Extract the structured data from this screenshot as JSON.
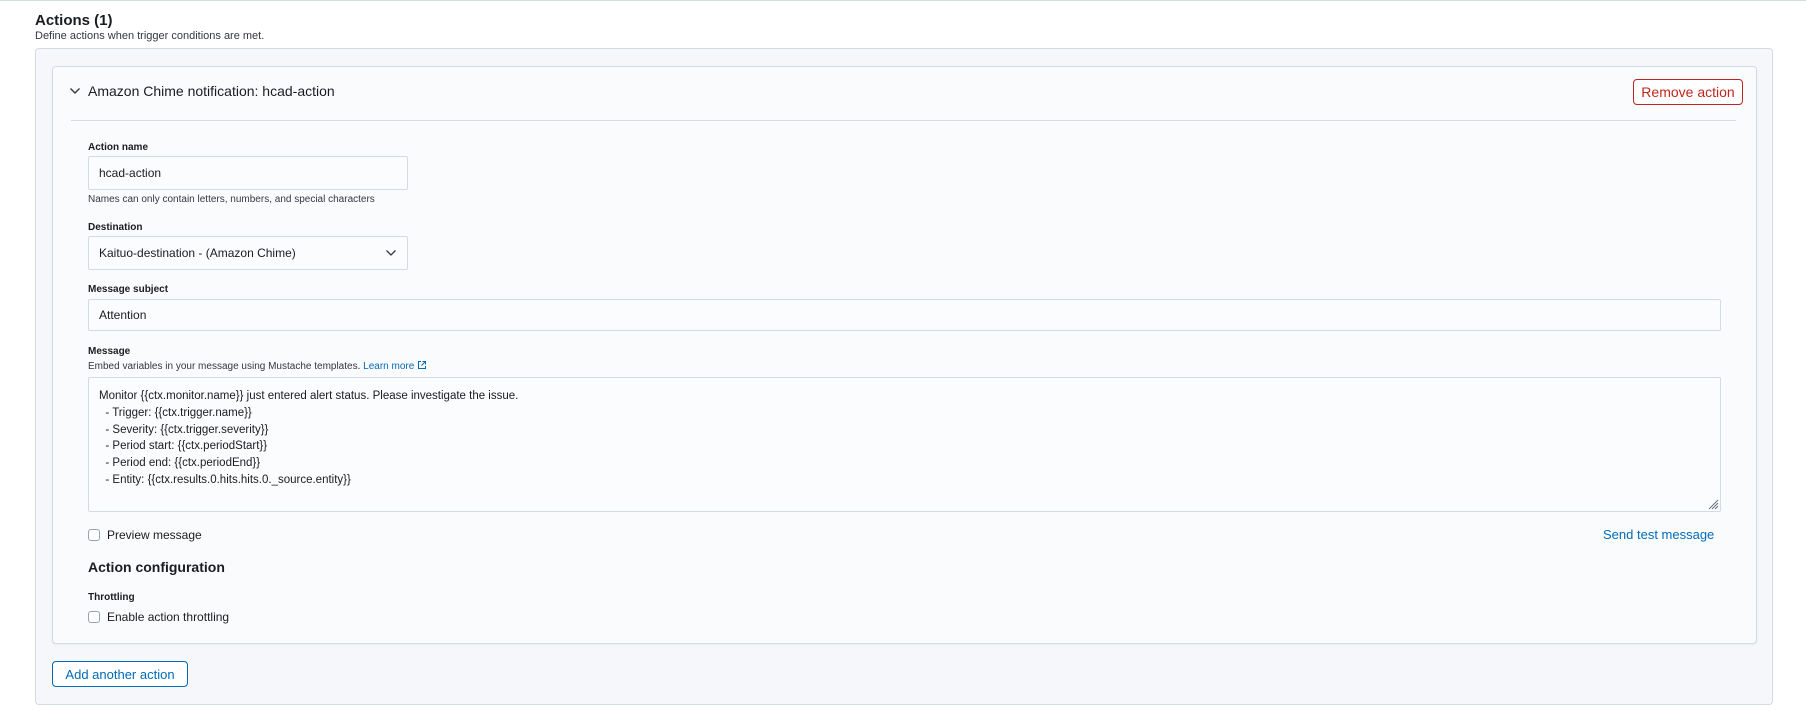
{
  "header": {
    "title": "Actions (1)",
    "description": "Define actions when trigger conditions are met."
  },
  "action": {
    "accordion_title": "Amazon Chime notification: hcad-action",
    "remove_label": "Remove action",
    "action_name": {
      "label": "Action name",
      "value": "hcad-action",
      "help": "Names can only contain letters, numbers, and special characters"
    },
    "destination": {
      "label": "Destination",
      "selected": "Kaituo-destination - (Amazon Chime)"
    },
    "message_subject": {
      "label": "Message subject",
      "value": "Attention"
    },
    "message": {
      "label": "Message",
      "help": "Embed variables in your message using Mustache templates.",
      "learn_more": "Learn more",
      "lines": [
        "Monitor {{ctx.monitor.name}} just entered alert status. Please investigate the issue.",
        "  - Trigger: {{ctx.trigger.name}}",
        "  - Severity: {{ctx.trigger.severity}}",
        "  - Period start: {{ctx.periodStart}}",
        "  - Period end: {{ctx.periodEnd}}",
        "  - Entity: {{ctx.results.0.hits.hits.0._source.entity}}"
      ]
    },
    "preview_label": "Preview message",
    "send_test_label": "Send test message",
    "configuration": {
      "title": "Action configuration",
      "throttling_label": "Throttling",
      "enable_throttling_label": "Enable action throttling"
    }
  },
  "add_another_label": "Add another action",
  "colors": {
    "primary": "#006bb8",
    "danger": "#bd271e",
    "border": "#d3dae6",
    "panel_bg": "#f5f7fa"
  }
}
